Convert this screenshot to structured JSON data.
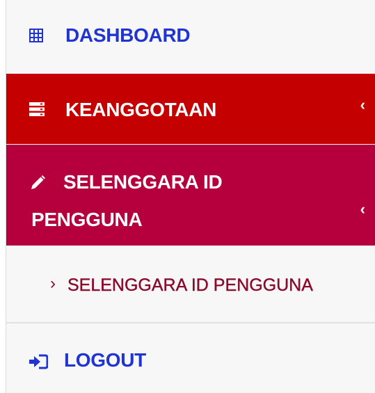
{
  "sidebar": {
    "items": [
      {
        "id": "dashboard",
        "label": "DASHBOARD",
        "icon": "table-grid-icon",
        "color": "#1f34d1"
      },
      {
        "id": "keanggotaan",
        "label": "KEANGGOTAAN",
        "icon": "server-stack-icon",
        "background": "#c50000",
        "chevron": "‹"
      },
      {
        "id": "selenggara",
        "label_line1": "SELENGGARA ID",
        "label_line2": "PENGGUNA",
        "icon": "pencil-icon",
        "background": "#b5003d",
        "chevron": "‹"
      }
    ],
    "subitem": {
      "caret": "›",
      "label": "SELENGGARA ID PENGGUNA",
      "color": "#8a0a2c"
    },
    "logout": {
      "label": "LOGOUT",
      "icon": "sign-in-arrow-icon",
      "color": "#1f34d1"
    }
  }
}
